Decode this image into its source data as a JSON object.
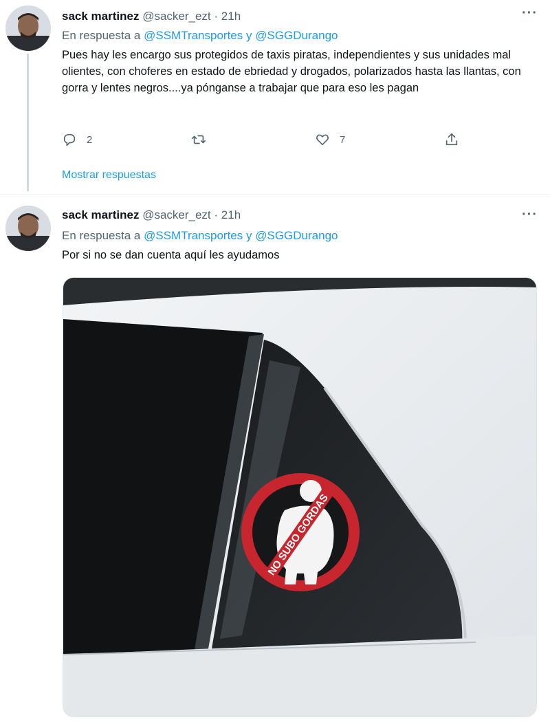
{
  "tweets": [
    {
      "author_name": "sack martinez",
      "handle": "@sacker_ezt",
      "separator": "·",
      "time": "21h",
      "replying_prefix": "En respuesta a",
      "mention1": "@SSMTransportes",
      "conjunction": "y",
      "mention2": "@SGGDurango",
      "text": "Pues hay les encargo sus protegidos de taxis piratas, independientes y sus unidades mal olientes, con choferes en estado de ebriedad y drogados, polarizados hasta las llantas, con gorra y lentes negros....ya pónganse a trabajar que para eso les pagan",
      "reply_count": "2",
      "retweet_count": "",
      "like_count": "7",
      "show_replies": "Mostrar respuestas"
    },
    {
      "author_name": "sack martinez",
      "handle": "@sacker_ezt",
      "separator": "·",
      "time": "21h",
      "replying_prefix": "En respuesta a",
      "mention1": "@SSMTransportes",
      "conjunction": "y",
      "mention2": "@SGGDurango",
      "text": "Por si no se dan cuenta aquí les ayudamos",
      "sticker_text": "NO SUBO GORDAS"
    }
  ],
  "icons": {
    "more": "more-icon",
    "reply": "reply-icon",
    "retweet": "retweet-icon",
    "like": "like-icon",
    "share": "share-icon"
  },
  "colors": {
    "accent": "#1d9bf0",
    "secondary_text": "#536471",
    "sticker_red": "#c8262e"
  }
}
